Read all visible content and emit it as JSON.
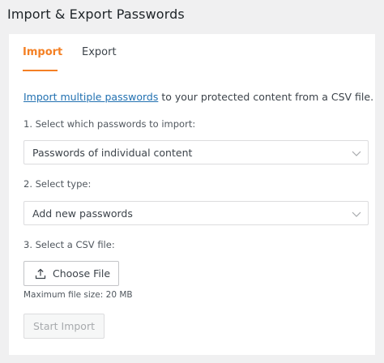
{
  "header": {
    "title": "Import & Export Passwords"
  },
  "tabs": [
    {
      "label": "Import",
      "active": true
    },
    {
      "label": "Export",
      "active": false
    }
  ],
  "intro": {
    "link_text": "Import multiple passwords",
    "rest_text": " to your protected content from a CSV file."
  },
  "step1": {
    "label": "1. Select which passwords to import:",
    "selected": "Passwords of individual content"
  },
  "step2": {
    "label": "2. Select type:",
    "selected": "Add new passwords"
  },
  "step3": {
    "label": "3. Select a CSV file:",
    "button_label": "Choose File",
    "hint": "Maximum file size: 20 MB"
  },
  "actions": {
    "start_label": "Start Import",
    "start_disabled": true
  },
  "colors": {
    "accent": "#f48024",
    "link": "#2271b1",
    "background": "#f0f0f1"
  },
  "icons": {
    "chevron": "chevron-down-icon",
    "upload": "upload-icon"
  }
}
